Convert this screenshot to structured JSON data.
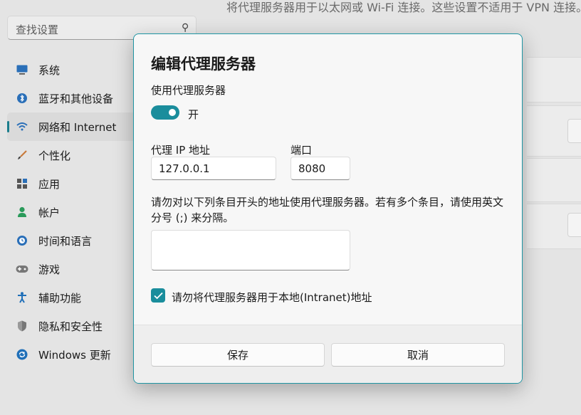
{
  "background": {
    "top_text": "将代理服务器用于以太网或 Wi-Fi 连接。这些设置不适用于 VPN 连接。",
    "search": {
      "placeholder": "查找设置",
      "icon": "search-icon"
    },
    "nav": [
      {
        "label": "系统",
        "icon": "monitor-icon",
        "color": "#2a6fb8"
      },
      {
        "label": "蓝牙和其他设备",
        "icon": "bluetooth-icon",
        "color": "#2a6fb8"
      },
      {
        "label": "网络和 Internet",
        "icon": "wifi-icon",
        "color": "#2a6fb8",
        "selected": true
      },
      {
        "label": "个性化",
        "icon": "brush-icon",
        "color": "#c87a3c"
      },
      {
        "label": "应用",
        "icon": "apps-icon",
        "color": "#555555"
      },
      {
        "label": "帐户",
        "icon": "person-icon",
        "color": "#2a9a5a"
      },
      {
        "label": "时间和语言",
        "icon": "globe-clock-icon",
        "color": "#2a6fb8"
      },
      {
        "label": "游戏",
        "icon": "gamepad-icon",
        "color": "#666666"
      },
      {
        "label": "辅助功能",
        "icon": "accessibility-icon",
        "color": "#1f6fb8"
      },
      {
        "label": "隐私和安全性",
        "icon": "shield-icon",
        "color": "#777777"
      },
      {
        "label": "Windows 更新",
        "icon": "update-icon",
        "color": "#1f6fb8"
      }
    ]
  },
  "dialog": {
    "title": "编辑代理服务器",
    "use_proxy_label": "使用代理服务器",
    "toggle": {
      "state_label": "开",
      "on": true
    },
    "ip_label": "代理 IP 地址",
    "ip_value": "127.0.0.1",
    "port_label": "端口",
    "port_value": "8080",
    "exceptions_description": "请勿对以下列条目开头的地址使用代理服务器。若有多个条目，请使用英文分号 (;) 来分隔。",
    "exceptions_value": "",
    "bypass_local": {
      "label": "请勿将代理服务器用于本地(Intranet)地址",
      "checked": true
    },
    "save_label": "保存",
    "cancel_label": "取消"
  },
  "colors": {
    "accent": "#1a8d9c",
    "dialog_border": "#1f95a3",
    "selected_indicator": "#1a7d8c"
  }
}
